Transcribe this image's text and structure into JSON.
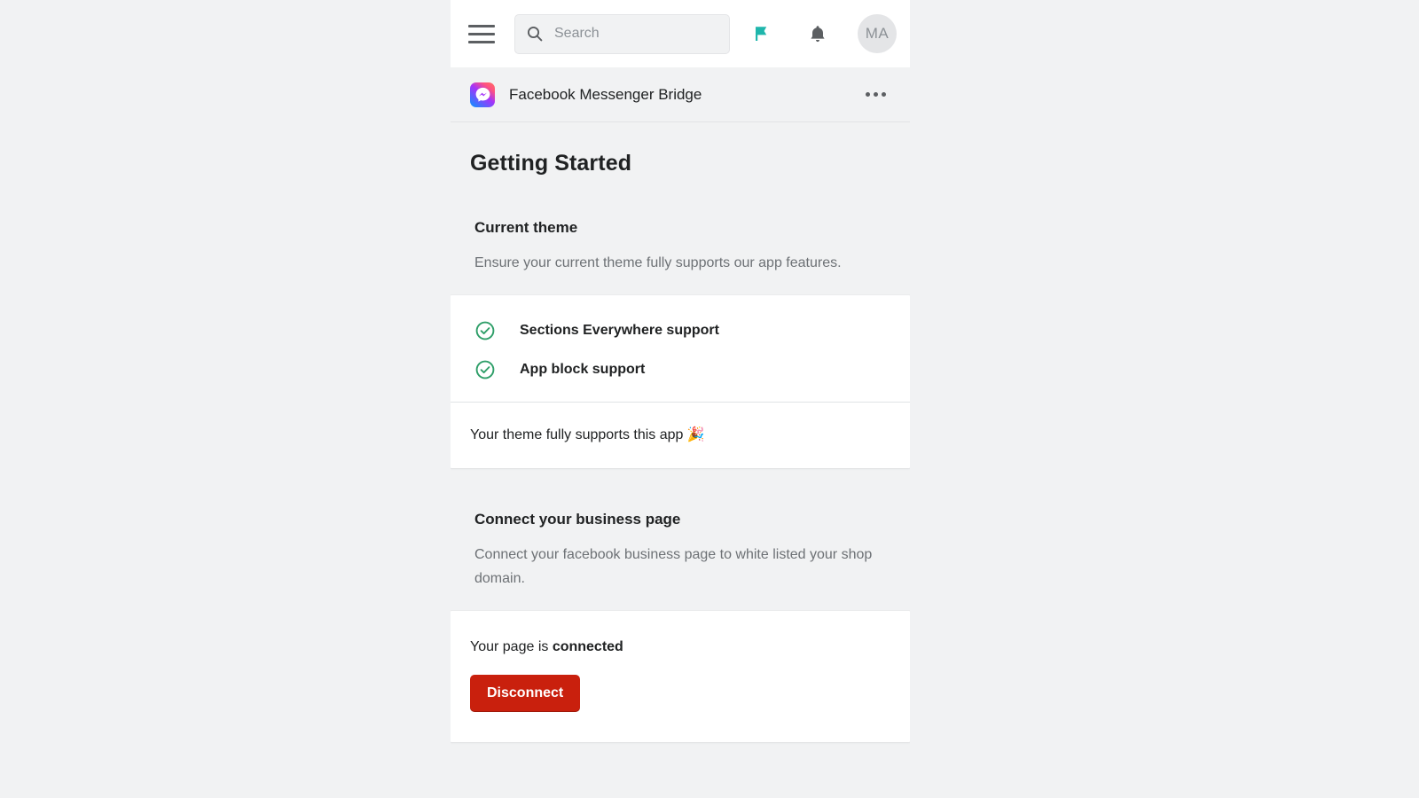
{
  "topbar": {
    "menu_icon": "hamburger-menu-icon",
    "search": {
      "icon": "search-icon",
      "placeholder": "Search",
      "value": ""
    },
    "flag_icon": "flag-icon",
    "flag_color": "#1fb6ac",
    "notifications_icon": "bell-icon",
    "avatar_initials": "MA"
  },
  "app_bar": {
    "logo_icon": "facebook-messenger-icon",
    "title": "Facebook Messenger Bridge",
    "more_label": "•••"
  },
  "page": {
    "title": "Getting Started"
  },
  "theme_section": {
    "heading": "Current theme",
    "description": "Ensure your current theme fully supports our app features.",
    "checks": [
      {
        "icon": "check-circle-icon",
        "label": "Sections Everywhere support"
      },
      {
        "icon": "check-circle-icon",
        "label": "App block support"
      }
    ],
    "footer": "Your theme fully supports this app 🎉",
    "check_color": "#2e9e68"
  },
  "connect_section": {
    "heading": "Connect your business page",
    "description": "Connect your facebook business page to white listed your shop domain.",
    "status_prefix": "Your page is ",
    "status_value": "connected",
    "disconnect_label": "Disconnect",
    "disconnect_color": "#c9200d"
  }
}
